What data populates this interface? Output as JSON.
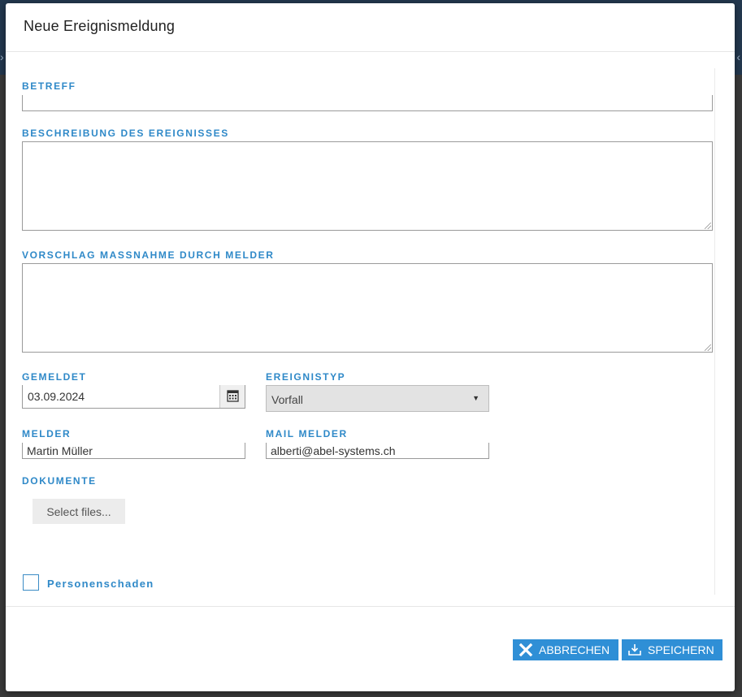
{
  "dialog": {
    "title": "Neue Ereignismeldung"
  },
  "form": {
    "betreff": {
      "label": "Betreff",
      "value": ""
    },
    "beschreibung": {
      "label": "Beschreibung des Ereignisses",
      "value": ""
    },
    "vorschlag": {
      "label": "Vorschlag Massnahme durch Melder",
      "value": ""
    },
    "gemeldet": {
      "label": "Gemeldet",
      "value": "03.09.2024",
      "icon": "calendar-icon"
    },
    "ereignistyp": {
      "label": "Ereignistyp",
      "value": "Vorfall",
      "icon": "caret-down-icon"
    },
    "melder": {
      "label": "Melder",
      "value": "Martin Müller"
    },
    "mail_melder": {
      "label": "Mail Melder",
      "value": "alberti@abel-systems.ch"
    },
    "dokumente": {
      "label": "Dokumente",
      "button_label": "Select files..."
    },
    "personenschaden": {
      "label": "Personenschaden",
      "checked": false
    }
  },
  "footer": {
    "cancel_label": "ABBRECHEN",
    "cancel_icon": "close-icon",
    "save_label": "SPEICHERN",
    "save_icon": "download-icon"
  },
  "colors": {
    "accent": "#2f8fd6",
    "label": "#2f89c8"
  }
}
